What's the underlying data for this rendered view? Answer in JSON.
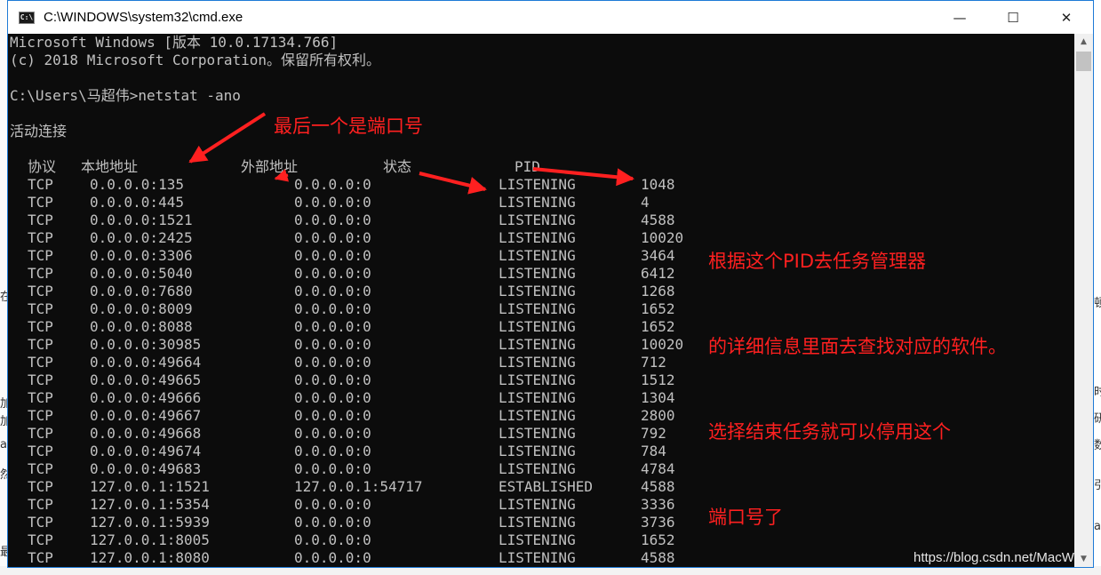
{
  "window": {
    "title": "C:\\WINDOWS\\system32\\cmd.exe",
    "icon": "cmd-icon",
    "controls": {
      "minimize": "—",
      "maximize": "☐",
      "close": "✕"
    }
  },
  "console": {
    "header_lines": [
      "Microsoft Windows [版本 10.0.17134.766]",
      "(c) 2018 Microsoft Corporation。保留所有权利。",
      "C:\\Users\\马超伟>netstat -ano",
      "活动连接"
    ],
    "columns": [
      "协议",
      "本地地址",
      "外部地址",
      "状态",
      "PID"
    ],
    "rows": [
      [
        "TCP",
        "0.0.0.0:135",
        "0.0.0.0:0",
        "LISTENING",
        "1048"
      ],
      [
        "TCP",
        "0.0.0.0:445",
        "0.0.0.0:0",
        "LISTENING",
        "4"
      ],
      [
        "TCP",
        "0.0.0.0:1521",
        "0.0.0.0:0",
        "LISTENING",
        "4588"
      ],
      [
        "TCP",
        "0.0.0.0:2425",
        "0.0.0.0:0",
        "LISTENING",
        "10020"
      ],
      [
        "TCP",
        "0.0.0.0:3306",
        "0.0.0.0:0",
        "LISTENING",
        "3464"
      ],
      [
        "TCP",
        "0.0.0.0:5040",
        "0.0.0.0:0",
        "LISTENING",
        "6412"
      ],
      [
        "TCP",
        "0.0.0.0:7680",
        "0.0.0.0:0",
        "LISTENING",
        "1268"
      ],
      [
        "TCP",
        "0.0.0.0:8009",
        "0.0.0.0:0",
        "LISTENING",
        "1652"
      ],
      [
        "TCP",
        "0.0.0.0:8088",
        "0.0.0.0:0",
        "LISTENING",
        "1652"
      ],
      [
        "TCP",
        "0.0.0.0:30985",
        "0.0.0.0:0",
        "LISTENING",
        "10020"
      ],
      [
        "TCP",
        "0.0.0.0:49664",
        "0.0.0.0:0",
        "LISTENING",
        "712"
      ],
      [
        "TCP",
        "0.0.0.0:49665",
        "0.0.0.0:0",
        "LISTENING",
        "1512"
      ],
      [
        "TCP",
        "0.0.0.0:49666",
        "0.0.0.0:0",
        "LISTENING",
        "1304"
      ],
      [
        "TCP",
        "0.0.0.0:49667",
        "0.0.0.0:0",
        "LISTENING",
        "2800"
      ],
      [
        "TCP",
        "0.0.0.0:49668",
        "0.0.0.0:0",
        "LISTENING",
        "792"
      ],
      [
        "TCP",
        "0.0.0.0:49674",
        "0.0.0.0:0",
        "LISTENING",
        "784"
      ],
      [
        "TCP",
        "0.0.0.0:49683",
        "0.0.0.0:0",
        "LISTENING",
        "4784"
      ],
      [
        "TCP",
        "127.0.0.1:1521",
        "127.0.0.1:54717",
        "ESTABLISHED",
        "4588"
      ],
      [
        "TCP",
        "127.0.0.1:5354",
        "0.0.0.0:0",
        "LISTENING",
        "3336"
      ],
      [
        "TCP",
        "127.0.0.1:5939",
        "0.0.0.0:0",
        "LISTENING",
        "3736"
      ],
      [
        "TCP",
        "127.0.0.1:8005",
        "0.0.0.0:0",
        "LISTENING",
        "1652"
      ],
      [
        "TCP",
        "127.0.0.1:8080",
        "0.0.0.0:0",
        "LISTENING",
        "4588"
      ]
    ]
  },
  "annotations": {
    "port_note": "最后一个是端口号",
    "pid_note": [
      "根据这个PID去任务管理器",
      "的详细信息里面去查找对应的软件。",
      "选择结束任务就可以停用这个",
      "端口号了"
    ],
    "color": "#ff2020"
  },
  "watermark": "https://blog.csdn.net/MacW",
  "background_fragments": [
    "在",
    "加",
    "加",
    "a",
    "然",
    "最",
    "顿",
    "时",
    "研",
    "数",
    "引",
    "a"
  ],
  "scrollbar": {
    "up": "▲",
    "down": "▼"
  }
}
